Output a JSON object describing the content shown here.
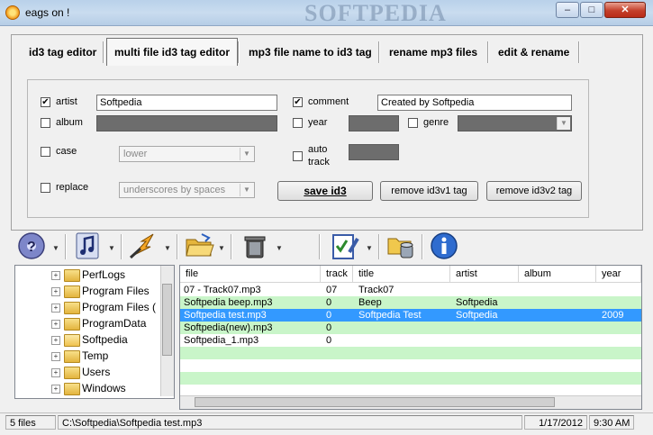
{
  "window": {
    "title": "eags on !",
    "watermark": "SOFTPEDIA",
    "min": "–",
    "max": "□",
    "close": "✕"
  },
  "tabs": [
    {
      "label": "id3 tag editor"
    },
    {
      "label": "multi file id3 tag editor"
    },
    {
      "label": "mp3 file name to id3 tag"
    },
    {
      "label": "rename mp3 files"
    },
    {
      "label": "edit & rename"
    }
  ],
  "form": {
    "artist": {
      "label": "artist",
      "checked": "✔",
      "value": "Softpedia"
    },
    "album": {
      "label": "album"
    },
    "case": {
      "label": "case",
      "value": "lower"
    },
    "replace": {
      "label": "replace",
      "value": "underscores by spaces"
    },
    "comment": {
      "label": "comment",
      "checked": "✔",
      "value": "Created by Softpedia"
    },
    "year": {
      "label": "year"
    },
    "genre": {
      "label": "genre"
    },
    "autotrack": {
      "label1": "auto",
      "label2": "track"
    },
    "save_label": "save id3",
    "remove_v1_label": "remove id3v1 tag",
    "remove_v2_label": "remove id3v2 tag"
  },
  "toolbar": {
    "arrow": "▼"
  },
  "tree": {
    "items": [
      {
        "label": "PerfLogs"
      },
      {
        "label": "Program Files"
      },
      {
        "label": "Program Files ("
      },
      {
        "label": "ProgramData"
      },
      {
        "label": "Softpedia"
      },
      {
        "label": "Temp"
      },
      {
        "label": "Users"
      },
      {
        "label": "Windows"
      }
    ],
    "expander": "+"
  },
  "filelist": {
    "columns": [
      "file",
      "track",
      "title",
      "artist",
      "album",
      "year"
    ],
    "rows": [
      {
        "file": "07 - Track07.mp3",
        "track": "07",
        "title": "Track07",
        "artist": "",
        "album": "",
        "year": ""
      },
      {
        "file": "Softpedia beep.mp3",
        "track": "0",
        "title": "Beep",
        "artist": "Softpedia",
        "album": "",
        "year": ""
      },
      {
        "file": "Softpedia test.mp3",
        "track": "0",
        "title": "Softpedia Test",
        "artist": "Softpedia",
        "album": "",
        "year": "2009"
      },
      {
        "file": "Softpedia(new).mp3",
        "track": "0",
        "title": "",
        "artist": "",
        "album": "",
        "year": ""
      },
      {
        "file": "Softpedia_1.mp3",
        "track": "0",
        "title": "",
        "artist": "",
        "album": "",
        "year": ""
      }
    ],
    "selected_row": 2
  },
  "status": {
    "count": "5 files",
    "path": "C:\\Softpedia\\Softpedia test.mp3",
    "date": "1/17/2012",
    "time": "9:30 AM"
  },
  "colors": {
    "row_green": "#c9f5c9",
    "selection": "#3399ff",
    "disabled_field": "#6d6d6d"
  }
}
